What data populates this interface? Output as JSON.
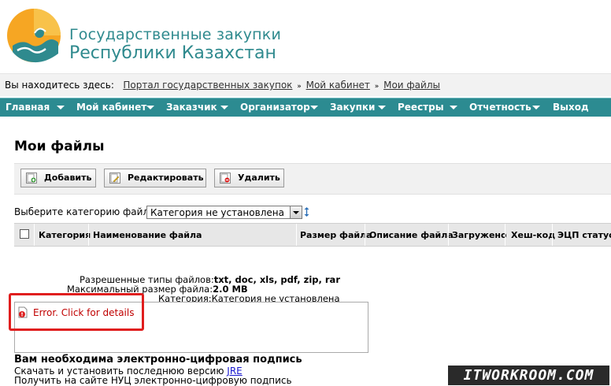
{
  "header": {
    "title_line1": "Государственные закупки",
    "title_line2": "Республики Казахстан"
  },
  "breadcrumbs": {
    "prefix": "Вы находитесь здесь:",
    "items": [
      "Портал государственных закупок",
      "Мой кабинет",
      "Мои файлы"
    ],
    "separator": "»"
  },
  "nav": {
    "items": [
      {
        "label": "Главная"
      },
      {
        "label": "Мой кабинет"
      },
      {
        "label": "Заказчик"
      },
      {
        "label": "Организатор"
      },
      {
        "label": "Закупки"
      },
      {
        "label": "Реестры"
      },
      {
        "label": "Отчетность"
      },
      {
        "label": "Выход"
      }
    ]
  },
  "page": {
    "title": "Мои файлы"
  },
  "toolbar": {
    "add_label": "Добавить",
    "edit_label": "Редактировать",
    "delete_label": "Удалить"
  },
  "filter": {
    "label": "Выберите категорию файлов:",
    "selected": "Категория не установлена"
  },
  "table": {
    "columns": [
      "Категория",
      "Наименование файла",
      "Размер файла",
      "Описание файла",
      "Загружено",
      "Хеш-код",
      "ЭЦП статус"
    ]
  },
  "upload_info": {
    "allowed_label": "Разрешенные типы файлов:",
    "allowed_value": "txt, doc, xls, pdf, zip, rar",
    "maxsize_label": "Максимальный размер файла:",
    "maxsize_value": "2.0 MB",
    "category_label": "Категория:",
    "category_value": "Категория не установлена"
  },
  "applet": {
    "error_text": "Error.  Click for details"
  },
  "signature": {
    "title": "Вам необходима электронно-цифровая подпись",
    "line1_text": "Скачать и установить последнюю версию ",
    "line1_link": "JRE",
    "line2_text": "Получить на сайте НУЦ электронно-цифровую подпись"
  },
  "watermark": "ITWORKROOM.COM",
  "colors": {
    "nav_bg": "#2c8b91",
    "logo_text": "#2f8a8e",
    "error_red": "#c00000",
    "highlight_border": "#e01e1e"
  }
}
